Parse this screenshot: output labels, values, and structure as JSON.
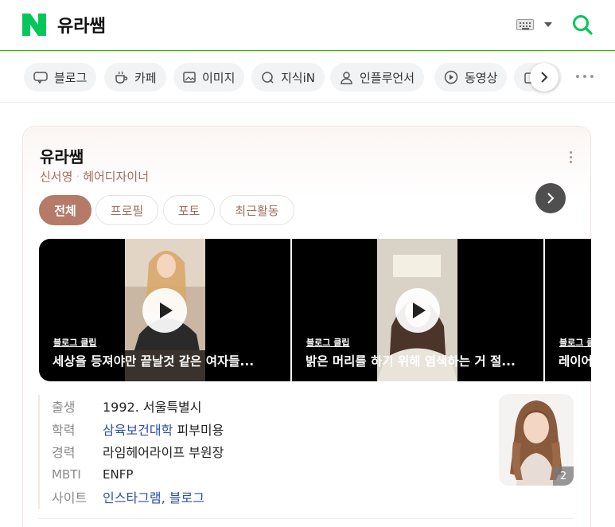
{
  "header": {
    "query": "유라쌤",
    "icons": [
      "naver-logo",
      "keyboard-icon",
      "dropdown-caret",
      "search-icon"
    ]
  },
  "tabs": [
    {
      "label": "블로그",
      "icon": "blog-icon"
    },
    {
      "label": "카페",
      "icon": "cafe-icon"
    },
    {
      "label": "이미지",
      "icon": "image-icon"
    },
    {
      "label": "지식iN",
      "icon": "kin-icon"
    },
    {
      "label": "인플루언서",
      "icon": "person-icon"
    },
    {
      "label": "동영상",
      "icon": "video-icon"
    }
  ],
  "profile": {
    "name": "유라쌤",
    "real_name": "신서영",
    "job": "헤어디자이너",
    "chips": [
      "전체",
      "프로필",
      "포토",
      "최근활동"
    ],
    "active_chip": "전체",
    "clips": [
      {
        "label": "블로그 클립",
        "title": "세상을 등져야만 끝날것 같은 여자들..."
      },
      {
        "label": "블로그 클립",
        "title": "밝은 머리를 하기 위해 염색하는 거 절..."
      },
      {
        "label": "블로그 클립",
        "title": "레이어드컷"
      }
    ],
    "info": [
      {
        "key": "출생",
        "value": "1992. 서울특별시"
      },
      {
        "key": "학력",
        "link": "삼육보건대학",
        "value": " 피부미용"
      },
      {
        "key": "경력",
        "value": "라임헤어라이프 부원장"
      },
      {
        "key": "MBTI",
        "value": "ENFP"
      },
      {
        "key": "사이트",
        "links": [
          "인스타그램",
          "블로그"
        ],
        "sep": ", "
      }
    ],
    "photo_count": "2"
  },
  "colors": {
    "naver_green": "#03c75a",
    "accent_brown": "#b57a68",
    "link_blue": "#2d4ea6"
  }
}
